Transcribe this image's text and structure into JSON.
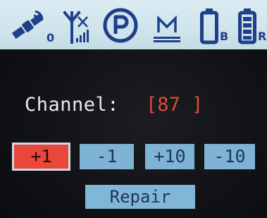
{
  "status_bar": {
    "gps_sub": "0",
    "battery_b_label": "B",
    "battery_r_label": "R"
  },
  "channel": {
    "label": "Channel:",
    "value": "[87 ]"
  },
  "buttons": {
    "plus_one": "+1",
    "minus_one": "-1",
    "plus_ten": "+10",
    "minus_ten": "-10",
    "repair": "Repair"
  },
  "colors": {
    "status_bar_bg": "#cfe4ec",
    "icon_blue": "#1f3f88",
    "channel_value": "#dd4b3b",
    "button_bg": "#7fb3d3",
    "button_active_bg": "#e8473a"
  },
  "icons": [
    "satellite-icon",
    "antenna-signal-icon",
    "parking-icon",
    "memory-icon",
    "battery-b-icon",
    "battery-r-icon"
  ]
}
